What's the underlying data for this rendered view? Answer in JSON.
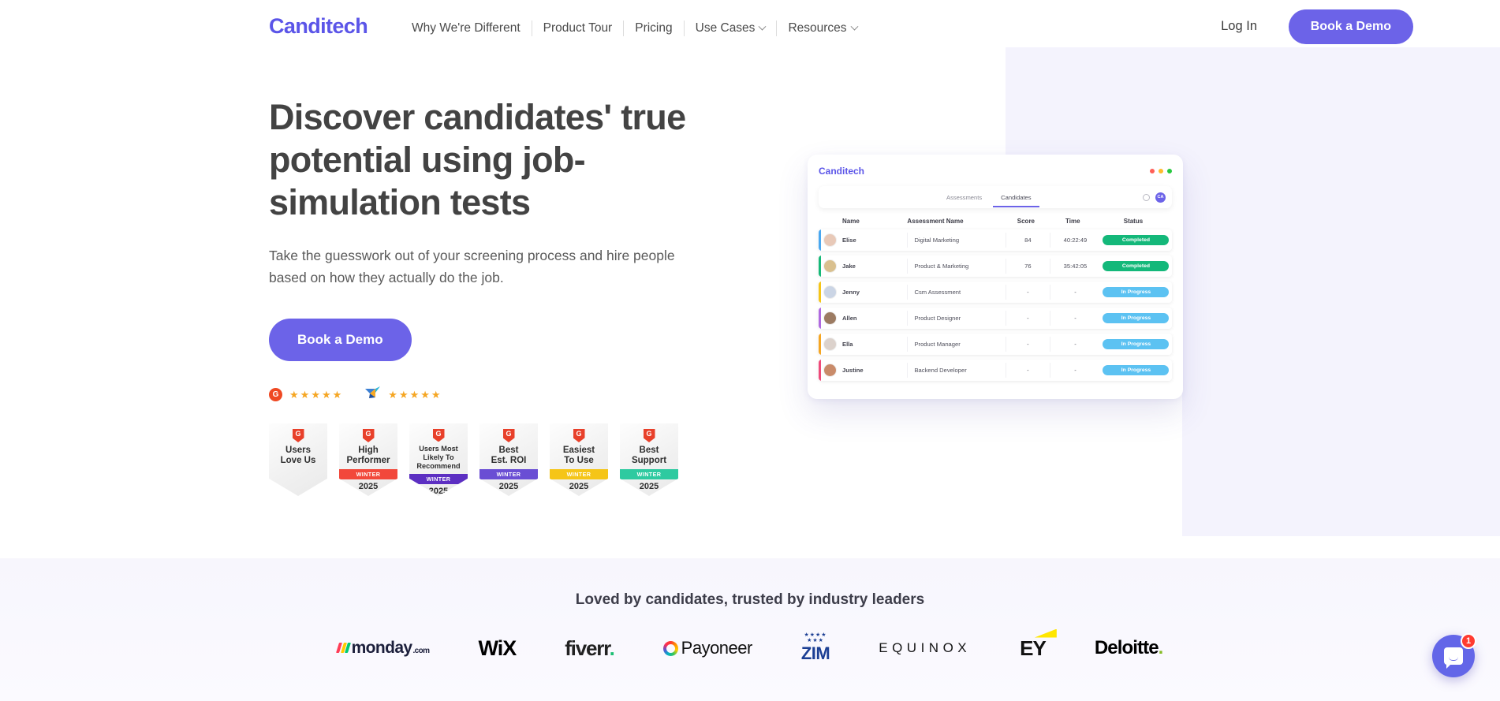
{
  "brand": {
    "name": "Canditech",
    "accent": "#5b55e8",
    "button_color": "#6c63e8"
  },
  "header": {
    "logo": "Canditech",
    "nav": [
      {
        "label": "Why We're Different",
        "has_chevron": false
      },
      {
        "label": "Product Tour",
        "has_chevron": false
      },
      {
        "label": "Pricing",
        "has_chevron": false
      },
      {
        "label": "Use Cases",
        "has_chevron": true
      },
      {
        "label": "Resources",
        "has_chevron": true
      }
    ],
    "login_label": "Log In",
    "cta_label": "Book a Demo"
  },
  "hero": {
    "headline": "Discover candidates' true potential using job-simulation tests",
    "subheadline": "Take the guesswork out of your screening process and hire people based on how they actually do the job.",
    "cta_label": "Book a Demo",
    "ratings": [
      {
        "source": "g2-icon",
        "mark": "G",
        "stars": 5,
        "star_color": "#f5a623"
      },
      {
        "source": "capterra-icon",
        "mark": "",
        "stars": 5,
        "star_color": "#f5a623"
      }
    ],
    "badges": [
      {
        "title": "Users\nLove Us",
        "ribbon": "",
        "year": "",
        "ribbon_color": "",
        "big": true
      },
      {
        "title": "High\nPerformer",
        "ribbon": "WINTER",
        "year": "2025",
        "ribbon_color": "#f2483b",
        "big": true
      },
      {
        "title": "Users Most\nLikely To\nRecommend",
        "ribbon": "WINTER",
        "year": "2025",
        "ribbon_color": "#5c2fc2",
        "big": false
      },
      {
        "title": "Best\nEst. ROI",
        "ribbon": "WINTER",
        "year": "2025",
        "ribbon_color": "#6a4ed4",
        "big": true
      },
      {
        "title": "Easiest\nTo Use",
        "ribbon": "WINTER",
        "year": "2025",
        "ribbon_color": "#f5c518",
        "big": true
      },
      {
        "title": "Best\nSupport",
        "ribbon": "WINTER",
        "year": "2025",
        "ribbon_color": "#2ecaa0",
        "big": true
      }
    ]
  },
  "mockup": {
    "app_name": "Canditech",
    "window_dots": [
      "#ff5f57",
      "#febc2e",
      "#28c840"
    ],
    "tabs": [
      {
        "label": "Assessments",
        "active": false
      },
      {
        "label": "Candidates",
        "active": true
      }
    ],
    "avatar_initials": "CA",
    "columns": [
      "Name",
      "Assessment Name",
      "Score",
      "Time",
      "Status"
    ],
    "rows": [
      {
        "name": "Elise",
        "assessment": "Digital Marketing",
        "score": "84",
        "time": "40:22:49",
        "status": "Completed",
        "status_type": "completed",
        "accent": "#4aa8f0",
        "avatar": "#e8c9b8"
      },
      {
        "name": "Jake",
        "assessment": "Product & Marketing",
        "score": "76",
        "time": "35:42:05",
        "status": "Completed",
        "status_type": "completed",
        "accent": "#17b978",
        "avatar": "#d9c08f"
      },
      {
        "name": "Jenny",
        "assessment": "Csm Assessment",
        "score": "-",
        "time": "-",
        "status": "In Progress",
        "status_type": "progress",
        "accent": "#f5c518",
        "avatar": "#cbd5e5"
      },
      {
        "name": "Allen",
        "assessment": "Product Designer",
        "score": "-",
        "time": "-",
        "status": "In Progress",
        "status_type": "progress",
        "accent": "#b06ae0",
        "avatar": "#9c7b62"
      },
      {
        "name": "Ella",
        "assessment": "Product Manager",
        "score": "-",
        "time": "-",
        "status": "In Progress",
        "status_type": "progress",
        "accent": "#f5a623",
        "avatar": "#dcd2cc"
      },
      {
        "name": "Justine",
        "assessment": "Backend Developer",
        "score": "-",
        "time": "-",
        "status": "In Progress",
        "status_type": "progress",
        "accent": "#ef4b7a",
        "avatar": "#c98b6a"
      }
    ]
  },
  "trusted": {
    "title": "Loved by candidates, trusted by industry leaders",
    "logos": [
      {
        "name": "monday.com",
        "key": "monday"
      },
      {
        "name": "WiX",
        "key": "wix"
      },
      {
        "name": "fiverr.",
        "key": "fiverr"
      },
      {
        "name": "Payoneer",
        "key": "payoneer"
      },
      {
        "name": "ZIM",
        "key": "zim"
      },
      {
        "name": "EQUINOX",
        "key": "equinox"
      },
      {
        "name": "EY",
        "key": "ey"
      },
      {
        "name": "Deloitte.",
        "key": "deloitte"
      }
    ]
  },
  "chat": {
    "badge_count": "1",
    "icon": "message-bubble-icon"
  }
}
